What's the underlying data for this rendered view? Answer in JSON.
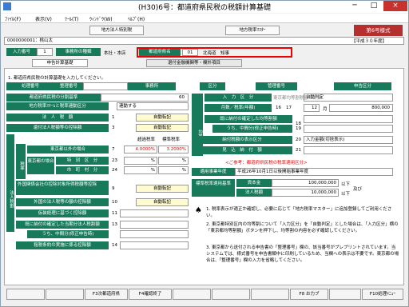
{
  "titlebar": {
    "title": "(H30)6号：都道府県民税の税額計算基礎",
    "min": "─",
    "max": "□",
    "close": "×"
  },
  "menu": {
    "file": "ﾌｧｲﾙ(F)",
    "view": "表示(V)",
    "tool": "ﾂｰﾙ(T)",
    "window": "ｳｨﾝﾄﾞｳ(W)",
    "help": "ﾍﾙﾌﾟ(H)"
  },
  "toolbar": {
    "corp": "地方法人特別税",
    "master": "地方税率ﾏｽﾀｰ",
    "form": "第6号様式"
  },
  "info": {
    "company": "0000000001：桃山太",
    "era": "【平成３０年度】"
  },
  "row1": {
    "input_no_lbl": "入力番号",
    "input_no": "1",
    "office_type_lbl": "事務所の種類",
    "office_type": "本社・本店",
    "pref_lbl": "都道府県名",
    "pref_code": "01",
    "pref_name": "北海道　知事"
  },
  "tabs": {
    "t1": "申告計算基礎",
    "t2": "退付金融機関等・欄外項目"
  },
  "instr": "1. 都道府県民税の計算基礎を入力してください。",
  "hdr": {
    "c1": "処理番号",
    "c2": "整理番号",
    "c3": "事務所",
    "c4": "区分",
    "c5": "管理番号",
    "c6": "申告区分"
  },
  "left": {
    "r1": "都道府県民税の分割基準",
    "r1v": "60",
    "r2": "地方税率ｽｷｰﾑと税率連動区分",
    "r2v": "連動する",
    "r3": "法　人　税　額",
    "r3n": "1",
    "r3v": "自動転記",
    "r4": "還付法人税額等の控除額",
    "r4n": "3",
    "r4v": "自動転記",
    "tax_lbl": "税率",
    "r5": "東京都以外の場合",
    "r5n": "7",
    "r5a": "4.0000%",
    "r5b": "3.2000%",
    "r5h1": "超過税率",
    "r5h2": "標準税率",
    "tokyo": "東京都の場合",
    "r6": "特　別　区　分",
    "r6n": "23",
    "r7": "市　町　村　分",
    "r7n": "24",
    "pct": "%",
    "sidebar": "法人税割",
    "r8": "外国関係会社の控除対象所得税額等控除",
    "r8n": "9",
    "r8v": "自動転記",
    "r9": "外国の法人税等の額の控除額",
    "r9n": "10",
    "r9v": "自動転記",
    "r10": "仮装経理に基づく控除額",
    "r10n": "11",
    "r11": "既に納付の確定した当期分法人税割額",
    "r11n": "13",
    "r12": "うち、中間分(修正申告時)",
    "r12n": "13",
    "r13": "租税条約の実施に係る控除額",
    "r13n": "14"
  },
  "right": {
    "side": "均等割",
    "input_kubun": "入　力　区　分",
    "input_kubun_v": "自動判定",
    "calc_mode": "東京都均等割税額の計算",
    "months": "月数／税率(年額)",
    "m16": "16",
    "m17": "17",
    "months_v": "12",
    "months_u": "月",
    "rate_v": "800,000",
    "paid": "既に納付の確定した均等割額",
    "n18": "18",
    "chukan": "うち、中間分(修正申告時)",
    "n19": "19",
    "report": "納付税額の表示区分",
    "n20": "20",
    "report_v": "入力金額(切捨表示)",
    "estim": "見　込　納　付　額",
    "n21": "21",
    "ref": "<ご参考：都道府県民税の税率適用区分>",
    "apply_lbl": "適用事業年度",
    "apply_v": "平成26年10月1日以後開始事業年度",
    "std_lbl": "標準税率適用基準",
    "cap_lbl": "資本金",
    "cap_v": "100,000,000",
    "cap_u": "以下",
    "tax_lbl": "法人税額",
    "tax_v": "10,000,000",
    "tax_u": "以下",
    "and": "及び"
  },
  "notes": {
    "n1": "1. 税率表示が適正か確認し、必要に応じて「地方税率マスター」に追加登録してご利用ください。",
    "n2": "2. 東京都特別区内の均等割について「入力区分」を「自動判定」とした場合は、「入力区分」横の「東京都均等割額」ボタンを押下し、均等割の内容を必ず確認してください。",
    "n3": "3. 東京都から送付される申告書の「整理番号」欄の、該当番号がプレプリントされています。当システムでは、様式番号を申告書類中に印刷しているため、当欄への表示は不要です。東京都の場合は、「整理番号」欄の入力を省略してください。"
  },
  "status": {
    "f3": "F3次都道府県",
    "f4": "F4確認終了",
    "f8": "F8 お力ブ",
    "f10": "F10処理ﾒﾆｭｰ"
  }
}
